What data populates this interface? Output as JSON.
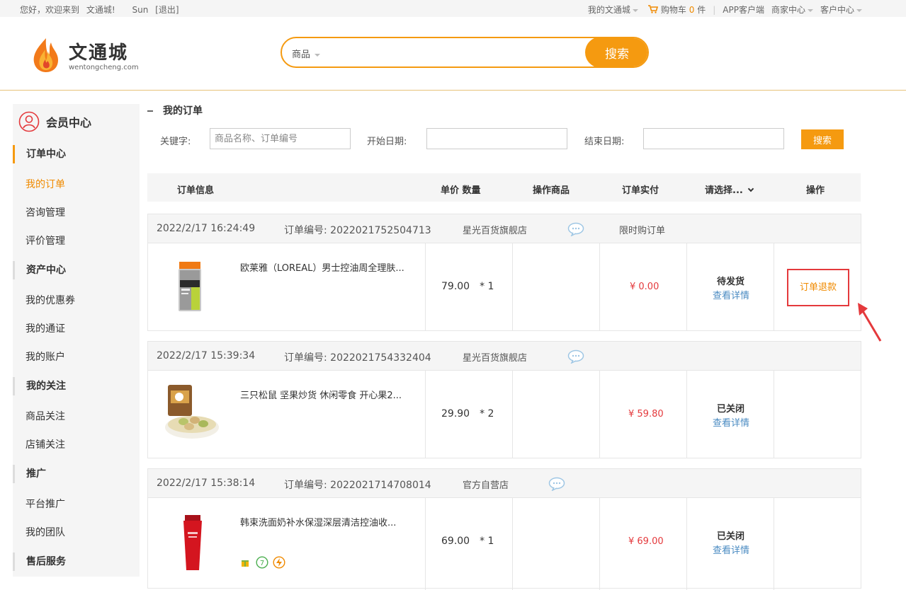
{
  "topbar": {
    "welcome": "您好，欢迎来到",
    "site": "文通城!",
    "user": "Sun",
    "logout": "[退出]",
    "my_site": "我的文通城",
    "cart_label": "购物车",
    "cart_count": "0",
    "cart_unit": "件",
    "app": "APP客户端",
    "merchant": "商家中心",
    "customer": "客户中心"
  },
  "logo": {
    "name": "文通城",
    "domain": "wentongcheng.com"
  },
  "search": {
    "category": "商品",
    "value": "",
    "button": "搜索"
  },
  "sidebar": {
    "title": "会员中心",
    "items": [
      {
        "label": "订单中心",
        "group": true
      },
      {
        "label": "我的订单",
        "active": true
      },
      {
        "label": "咨询管理"
      },
      {
        "label": "评价管理"
      },
      {
        "label": "资产中心",
        "group": true
      },
      {
        "label": "我的优惠券"
      },
      {
        "label": "我的通证"
      },
      {
        "label": "我的账户"
      },
      {
        "label": "我的关注",
        "group": true
      },
      {
        "label": "商品关注"
      },
      {
        "label": "店铺关注"
      },
      {
        "label": "推广",
        "group": true
      },
      {
        "label": "平台推广"
      },
      {
        "label": "我的团队"
      },
      {
        "label": "售后服务",
        "group": true
      }
    ]
  },
  "main": {
    "title": "我的订单",
    "filter": {
      "keyword_label": "关键字:",
      "keyword_placeholder": "商品名称、订单编号",
      "start_label": "开始日期:",
      "end_label": "结束日期:",
      "button": "搜索"
    },
    "columns": {
      "info": "订单信息",
      "price_qty": "单价 数量",
      "op_goods": "操作商品",
      "paid": "订单实付",
      "select": "请选择...",
      "action": "操作"
    },
    "orders": [
      {
        "time": "2022/2/17 16:24:49",
        "order_no": "订单编号: 2022021752504713",
        "shop": "星光百货旗舰店",
        "tag": "限时购订单",
        "product": "欧莱雅（LOREAL）男士控油周全理肤...",
        "price": "79.00",
        "qty": "* 1",
        "paid": "¥ 0.00",
        "status": "待发货",
        "detail": "查看详情",
        "action": "订单退款"
      },
      {
        "time": "2022/2/17 15:39:34",
        "order_no": "订单编号: 2022021754332404",
        "shop": "星光百货旗舰店",
        "tag": "",
        "product": "三只松鼠 坚果炒货 休闲零食 开心果2...",
        "price": "29.90",
        "qty": "* 2",
        "paid": "¥ 59.80",
        "status": "已关闭",
        "detail": "查看详情",
        "action": ""
      },
      {
        "time": "2022/2/17 15:38:14",
        "order_no": "订单编号: 2022021714708014",
        "shop": "官方自营店",
        "tag": "",
        "product": "韩束洗面奶补水保湿深层清洁控油收...",
        "price": "69.00",
        "qty": "* 1",
        "paid": "¥ 69.00",
        "status": "已关闭",
        "detail": "查看详情",
        "action": ""
      }
    ]
  },
  "colors": {
    "accent": "#f59a10",
    "price_red": "#e4393c",
    "link_blue": "#4a8bc2"
  },
  "icons": [
    "cart-icon",
    "flame-logo-icon",
    "user-circle-icon",
    "chat-bubble-icon",
    "arrow-pointer-icon"
  ]
}
